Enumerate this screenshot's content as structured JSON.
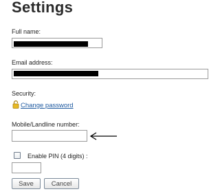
{
  "page": {
    "title": "Settings"
  },
  "form": {
    "full_name": {
      "label": "Full name:",
      "value": ""
    },
    "email": {
      "label": "Email address:",
      "value": ""
    },
    "security": {
      "label": "Security:",
      "link": "Change password",
      "icon": "lock-icon"
    },
    "mobile": {
      "label": "Mobile/Landline number:",
      "value": ""
    },
    "pin": {
      "label": "Enable PIN (4 digits) :",
      "checked": false,
      "value": ""
    }
  },
  "buttons": {
    "save": "Save",
    "cancel": "Cancel"
  },
  "annotation": {
    "icon": "arrow-left-icon"
  }
}
